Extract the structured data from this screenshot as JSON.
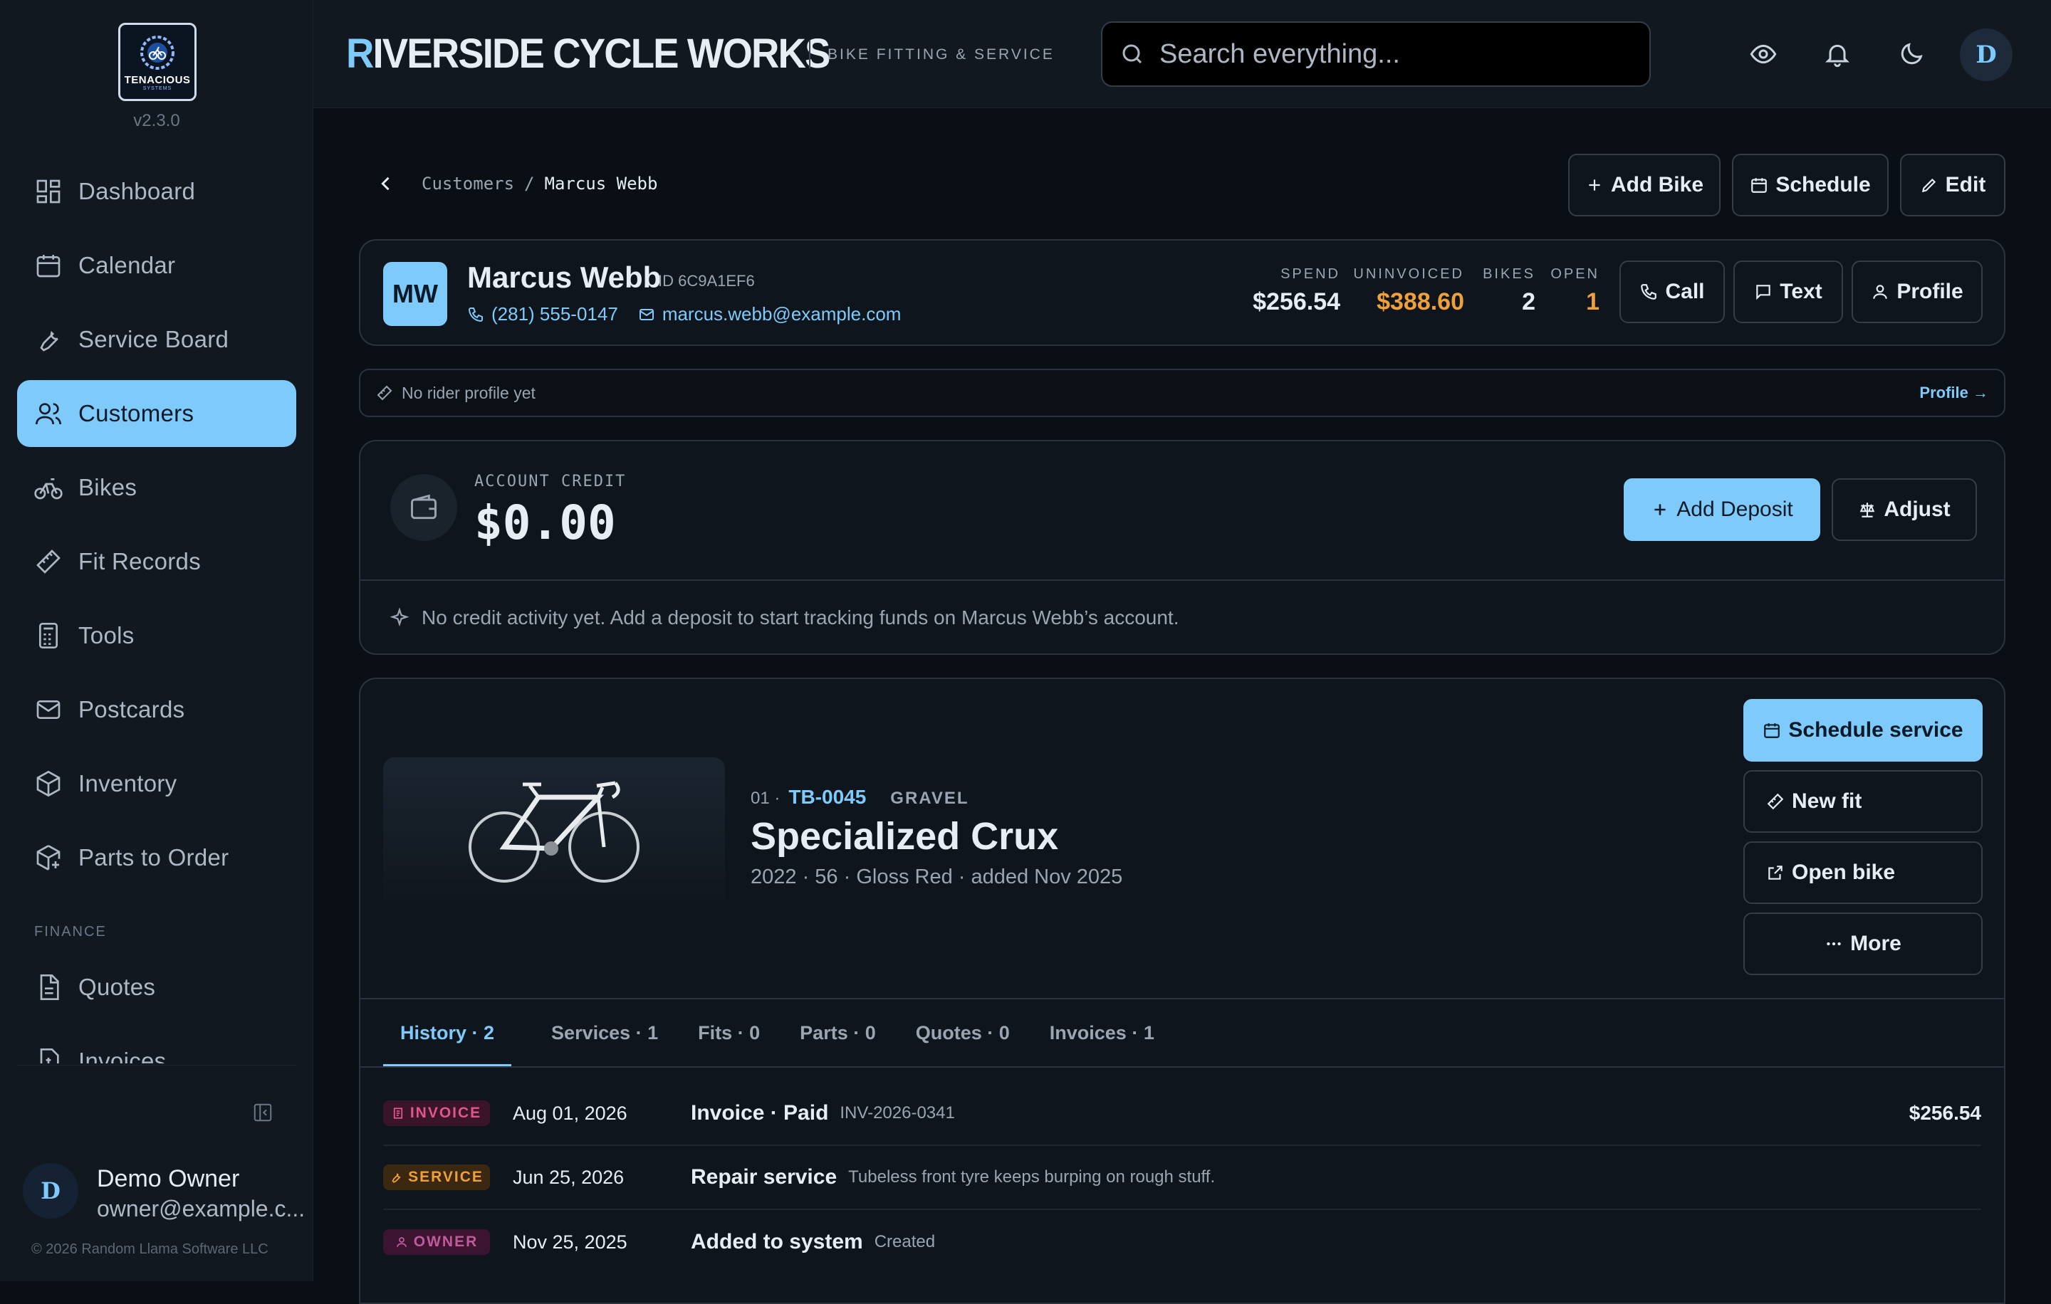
{
  "sidebar": {
    "logo_text": "TENACIOUS",
    "logo_sub": "SYSTEMS",
    "version": "v2.3.0",
    "items": [
      {
        "label": "Dashboard"
      },
      {
        "label": "Calendar"
      },
      {
        "label": "Service Board"
      },
      {
        "label": "Customers"
      },
      {
        "label": "Bikes"
      },
      {
        "label": "Fit Records"
      },
      {
        "label": "Tools"
      },
      {
        "label": "Postcards"
      },
      {
        "label": "Inventory"
      },
      {
        "label": "Parts to Order"
      }
    ],
    "section_finance": "FINANCE",
    "finance_items": [
      {
        "label": "Quotes"
      },
      {
        "label": "Invoices"
      }
    ],
    "user": {
      "initial": "D",
      "name": "Demo Owner",
      "email": "owner@example.c..."
    },
    "copyright": "© 2026 Random Llama Software LLC"
  },
  "header": {
    "brand_first": "R",
    "brand_rest": "IVERSIDE CYCLE WORKS",
    "subtitle": "BIKE FITTING & SERVICE",
    "search_placeholder": "Search everything...",
    "avatar": "D"
  },
  "breadcrumb": {
    "parent": "Customers",
    "sep": "/",
    "current": "Marcus Webb"
  },
  "actions": {
    "add_bike": "Add Bike",
    "schedule": "Schedule",
    "edit": "Edit"
  },
  "customer": {
    "initials": "MW",
    "name": "Marcus Webb",
    "id": "ID 6C9A1EF6",
    "phone": "(281) 555-0147",
    "email": "marcus.webb@example.com",
    "stats": [
      {
        "label": "SPEND",
        "value": "$256.54",
        "color": "#e6edf3"
      },
      {
        "label": "UNINVOICED",
        "value": "$388.60",
        "color": "#f0a03a"
      },
      {
        "label": "BIKES",
        "value": "2",
        "color": "#e6edf3"
      },
      {
        "label": "OPEN",
        "value": "1",
        "color": "#f0a03a"
      }
    ],
    "call": "Call",
    "text": "Text",
    "profile": "Profile"
  },
  "rider_note": {
    "text": "No rider profile yet",
    "link": "Profile →"
  },
  "credit": {
    "label": "ACCOUNT CREDIT",
    "value": "$0.00",
    "add_deposit": "Add Deposit",
    "adjust": "Adjust",
    "note": "No credit activity yet. Add a deposit to start tracking funds on Marcus Webb’s account."
  },
  "bike": {
    "index": "01 ·",
    "code": "TB-0045",
    "type": "GRAVEL",
    "title": "Specialized Crux",
    "subtitle": "2022 · 56 · Gloss Red · added Nov 2025",
    "schedule_service": "Schedule service",
    "new_fit": "New fit",
    "open_bike": "Open bike",
    "more": "More",
    "tabs": [
      {
        "label": "History · 2"
      },
      {
        "label": "Services · 1"
      },
      {
        "label": "Fits · 0"
      },
      {
        "label": "Parts · 0"
      },
      {
        "label": "Quotes · 0"
      },
      {
        "label": "Invoices · 1"
      }
    ],
    "history": [
      {
        "badge": "INVOICE",
        "date": "Aug 01, 2026",
        "title": "Invoice · Paid",
        "desc": "INV-2026-0341",
        "amount": "$256.54"
      },
      {
        "badge": "SERVICE",
        "date": "Jun 25, 2026",
        "title": "Repair service",
        "desc": "Tubeless front tyre keeps burping on rough stuff.",
        "amount": ""
      },
      {
        "badge": "OWNER",
        "date": "Nov 25, 2025",
        "title": "Added to system",
        "desc": "Created",
        "amount": ""
      }
    ]
  },
  "colors": {
    "accent": "#7ecbfb",
    "warning": "#f0a03a",
    "background": "#0a0f15"
  }
}
